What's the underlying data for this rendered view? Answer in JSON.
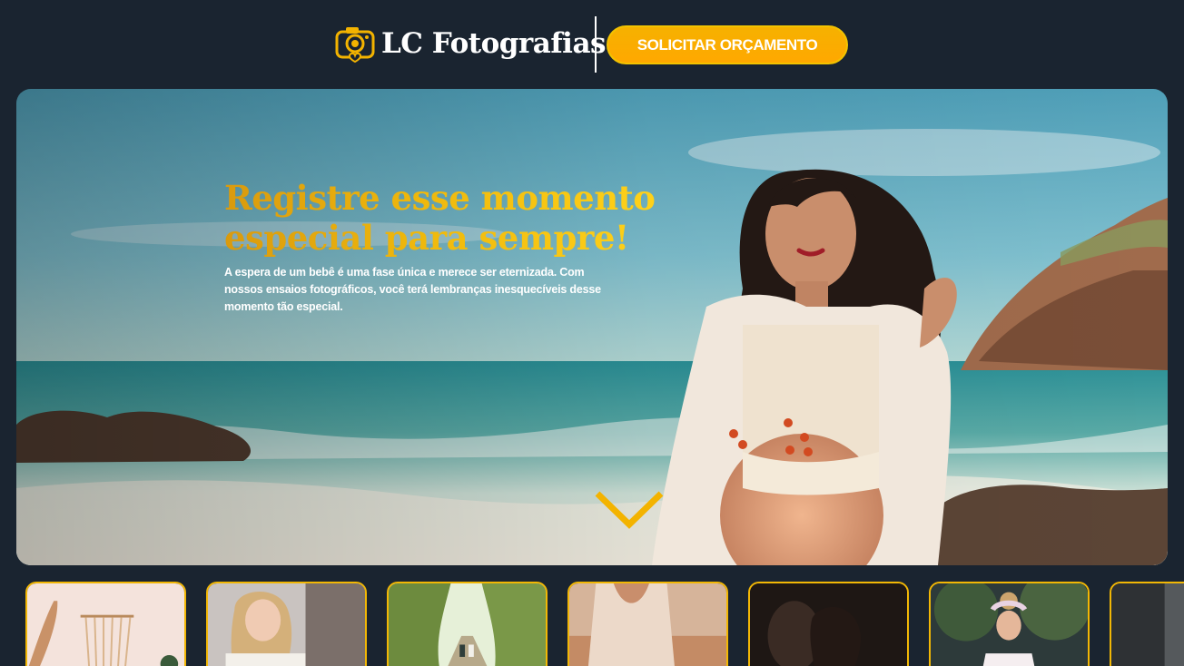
{
  "brand": {
    "name": "LC Fotografias",
    "logo_icon": "camera-heart-icon",
    "accent": "#f6b100"
  },
  "header": {
    "cta_label": "SOLICITAR ORÇAMENTO"
  },
  "hero": {
    "title": "Registre esse momento especial para sempre!",
    "description": "A espera de um bebê é uma fase única e merece ser eternizada. Com nossos ensaios fotográficos, você terá lembranças inesquecíveis desse momento tão especial.",
    "scroll_icon": "chevron-down-icon"
  },
  "gallery": {
    "items": [
      {
        "name": "thumb-boho-decor"
      },
      {
        "name": "thumb-blonde-woman"
      },
      {
        "name": "thumb-forest-path"
      },
      {
        "name": "thumb-lace-dress"
      },
      {
        "name": "thumb-couple-dark"
      },
      {
        "name": "thumb-flower-crown"
      },
      {
        "name": "thumb-gray"
      }
    ]
  }
}
